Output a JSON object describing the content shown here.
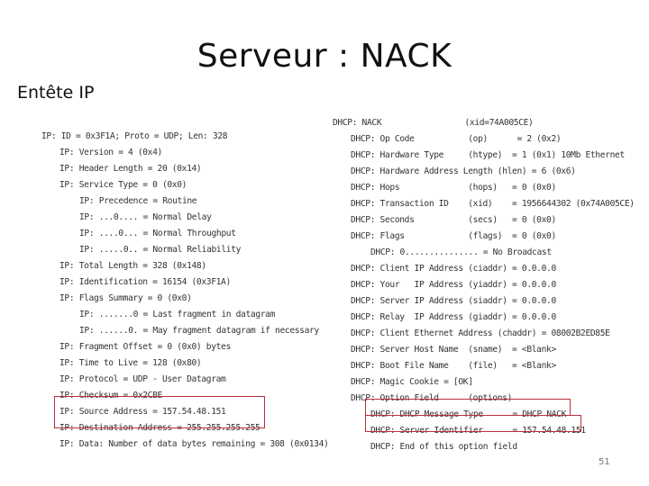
{
  "slide": {
    "title": "Serveur : NACK",
    "section_label": "Entête IP",
    "page_number": "51",
    "highlight_color": "#b8303a"
  },
  "ip_header": {
    "lines": [
      {
        "indent": 0,
        "text": "IP: ID = 0x3F1A; Proto = UDP; Len: 328"
      },
      {
        "indent": 1,
        "text": "IP: Version = 4 (0x4)"
      },
      {
        "indent": 1,
        "text": "IP: Header Length = 20 (0x14)"
      },
      {
        "indent": 1,
        "text": "IP: Service Type = 0 (0x0)"
      },
      {
        "indent": 2,
        "text": "IP: Precedence = Routine"
      },
      {
        "indent": 2,
        "text": "IP: ...0.... = Normal Delay"
      },
      {
        "indent": 2,
        "text": "IP: ....0... = Normal Throughput"
      },
      {
        "indent": 2,
        "text": "IP: .....0.. = Normal Reliability"
      },
      {
        "indent": 1,
        "text": "IP: Total Length = 328 (0x148)"
      },
      {
        "indent": 1,
        "text": "IP: Identification = 16154 (0x3F1A)"
      },
      {
        "indent": 1,
        "text": "IP: Flags Summary = 0 (0x0)"
      },
      {
        "indent": 2,
        "text": "IP: .......0 = Last fragment in datagram"
      },
      {
        "indent": 2,
        "text": "IP: ......0. = May fragment datagram if necessary"
      },
      {
        "indent": 1,
        "text": "IP: Fragment Offset = 0 (0x0) bytes"
      },
      {
        "indent": 1,
        "text": "IP: Time to Live = 128 (0x80)"
      },
      {
        "indent": 1,
        "text": "IP: Protocol = UDP - User Datagram"
      },
      {
        "indent": 1,
        "text": "IP: Checksum = 0x2CBE"
      },
      {
        "indent": 1,
        "text": "IP: Source Address = 157.54.48.151",
        "highlighted": true
      },
      {
        "indent": 1,
        "text": "IP: Destination Address = 255.255.255.255",
        "highlighted": true
      },
      {
        "indent": 1,
        "text": "IP: Data: Number of data bytes remaining = 308 (0x0134)"
      }
    ]
  },
  "dhcp": {
    "lines": [
      {
        "indent": 0,
        "text": "DHCP: NACK                 (xid=74A005CE)"
      },
      {
        "indent": 1,
        "text": "DHCP: Op Code           (op)      = 2 (0x2)"
      },
      {
        "indent": 1,
        "text": "DHCP: Hardware Type     (htype)  = 1 (0x1) 10Mb Ethernet"
      },
      {
        "indent": 1,
        "text": "DHCP: Hardware Address Length (hlen) = 6 (0x6)"
      },
      {
        "indent": 1,
        "text": "DHCP: Hops              (hops)   = 0 (0x0)"
      },
      {
        "indent": 1,
        "text": "DHCP: Transaction ID    (xid)    = 1956644302 (0x74A005CE)"
      },
      {
        "indent": 1,
        "text": "DHCP: Seconds           (secs)   = 0 (0x0)"
      },
      {
        "indent": 1,
        "text": "DHCP: Flags             (flags)  = 0 (0x0)"
      },
      {
        "indent": 2,
        "text": "DHCP: 0............... = No Broadcast"
      },
      {
        "indent": 1,
        "text": "DHCP: Client IP Address (ciaddr) = 0.0.0.0"
      },
      {
        "indent": 1,
        "text": "DHCP: Your   IP Address (yiaddr) = 0.0.0.0"
      },
      {
        "indent": 1,
        "text": "DHCP: Server IP Address (siaddr) = 0.0.0.0"
      },
      {
        "indent": 1,
        "text": "DHCP: Relay  IP Address (giaddr) = 0.0.0.0"
      },
      {
        "indent": 1,
        "text": "DHCP: Client Ethernet Address (chaddr) = 08002B2ED85E"
      },
      {
        "indent": 1,
        "text": "DHCP: Server Host Name  (sname)  = <Blank>"
      },
      {
        "indent": 1,
        "text": "DHCP: Boot File Name    (file)   = <Blank>"
      },
      {
        "indent": 1,
        "text": "DHCP: Magic Cookie = [OK]"
      },
      {
        "indent": 1,
        "text": "DHCP: Option Field      (options)"
      },
      {
        "indent": 2,
        "text": "DHCP: DHCP Message Type      = DHCP NACK",
        "highlighted": true
      },
      {
        "indent": 2,
        "text": "DHCP: Server Identifier      = 157.54.48.151",
        "highlighted": true
      },
      {
        "indent": 2,
        "text": "DHCP: End of this option field"
      }
    ]
  }
}
